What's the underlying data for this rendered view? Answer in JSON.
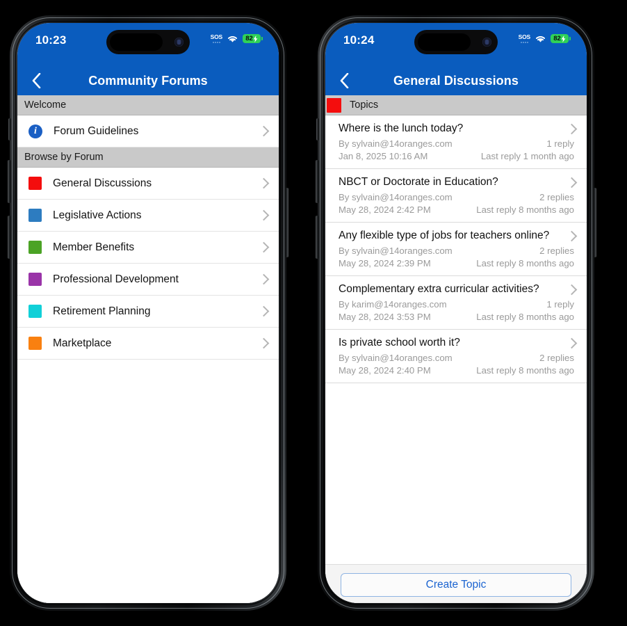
{
  "background_color": "#000000",
  "theme": {
    "navbar_blue": "#0a5cbe",
    "section_gray": "#c9c9c9",
    "link_blue": "#1a63d0",
    "chevron_gray": "#b5b5b5",
    "meta_gray": "#9a9a9a"
  },
  "phones": [
    {
      "status_bar": {
        "time": "10:23",
        "sos_label": "SOS",
        "wifi_icon": "wifi-icon",
        "battery_level": "82",
        "battery_charging": true,
        "battery_color": "#2fd158"
      },
      "nav": {
        "back_icon": "chevron-left-icon",
        "title": "Community Forums"
      },
      "sections": [
        {
          "header": "Welcome",
          "header_swatch": null,
          "rows": [
            {
              "label": "Forum Guidelines",
              "icon": "info-circle-icon",
              "swatch": null
            }
          ]
        },
        {
          "header": "Browse by Forum",
          "header_swatch": null,
          "rows": [
            {
              "label": "General Discussions",
              "icon": "color-swatch-icon",
              "swatch": "#f40d0d"
            },
            {
              "label": "Legislative Actions",
              "icon": "color-swatch-icon",
              "swatch": "#2d7cc0"
            },
            {
              "label": "Member Benefits",
              "icon": "color-swatch-icon",
              "swatch": "#4ba325"
            },
            {
              "label": "Professional Development",
              "icon": "color-swatch-icon",
              "swatch": "#9a34a8"
            },
            {
              "label": "Retirement Planning",
              "icon": "color-swatch-icon",
              "swatch": "#11d0d8"
            },
            {
              "label": "Marketplace",
              "icon": "color-swatch-icon",
              "swatch": "#f98010"
            }
          ]
        }
      ],
      "footer": null
    },
    {
      "status_bar": {
        "time": "10:24",
        "sos_label": "SOS",
        "wifi_icon": "wifi-icon",
        "battery_level": "82",
        "battery_charging": true,
        "battery_color": "#2fd158"
      },
      "nav": {
        "back_icon": "chevron-left-icon",
        "title": "General Discussions"
      },
      "topics_header": {
        "label": "Topics",
        "swatch": "#f40d0d"
      },
      "topics": [
        {
          "title": "Where is the lunch today?",
          "author": "By sylvain@14oranges.com",
          "date": "Jan 8, 2025 10:16 AM",
          "replies": "1 reply",
          "last_reply": "Last reply 1 month ago"
        },
        {
          "title": "NBCT or Doctorate in Education?",
          "author": "By sylvain@14oranges.com",
          "date": "May 28, 2024 2:42 PM",
          "replies": "2 replies",
          "last_reply": "Last reply 8 months ago"
        },
        {
          "title": "Any flexible type of jobs for teachers online?",
          "author": "By sylvain@14oranges.com",
          "date": "May 28, 2024 2:39 PM",
          "replies": "2 replies",
          "last_reply": "Last reply 8 months ago"
        },
        {
          "title": "Complementary extra curricular activities?",
          "author": "By karim@14oranges.com",
          "date": "May 28, 2024 3:53 PM",
          "replies": "1 reply",
          "last_reply": "Last reply 8 months ago"
        },
        {
          "title": "Is private school worth it?",
          "author": "By sylvain@14oranges.com",
          "date": "May 28, 2024 2:40 PM",
          "replies": "2 replies",
          "last_reply": "Last reply 8 months ago"
        }
      ],
      "footer": {
        "create_button_label": "Create Topic"
      }
    }
  ]
}
